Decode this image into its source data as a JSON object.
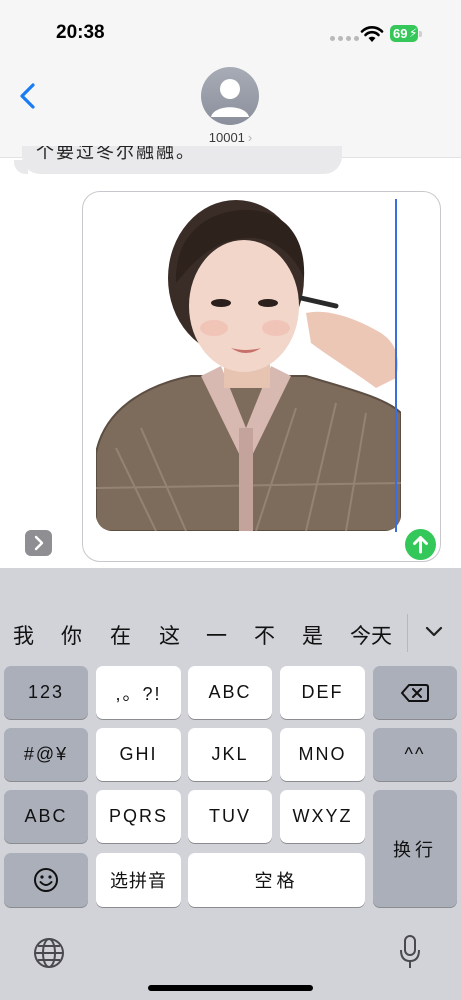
{
  "status_bar": {
    "time": "20:38",
    "battery": "69"
  },
  "header": {
    "contact_name": "10001",
    "contact_chevron": "›"
  },
  "chat": {
    "previous_message_fragment": "个要过冬尔融融。"
  },
  "candidates": [
    "我",
    "你",
    "在",
    "这",
    "一",
    "不",
    "是",
    "今天"
  ],
  "keyboard": {
    "row1": {
      "left": "123",
      "k1": ",。?!",
      "k2": "ABC",
      "k3": "DEF"
    },
    "row2": {
      "left": "#@¥",
      "k1": "GHI",
      "k2": "JKL",
      "k3": "MNO",
      "right": "^^"
    },
    "row3": {
      "left": "ABC",
      "k1": "PQRS",
      "k2": "TUV",
      "k3": "WXYZ",
      "enter": "换行"
    },
    "row4": {
      "k1": "选拼音",
      "space": "空格"
    }
  },
  "colors": {
    "send": "#34c759",
    "accent": "#1a7cf5",
    "battery": "#35c759",
    "cursor": "#3b6fe0"
  }
}
